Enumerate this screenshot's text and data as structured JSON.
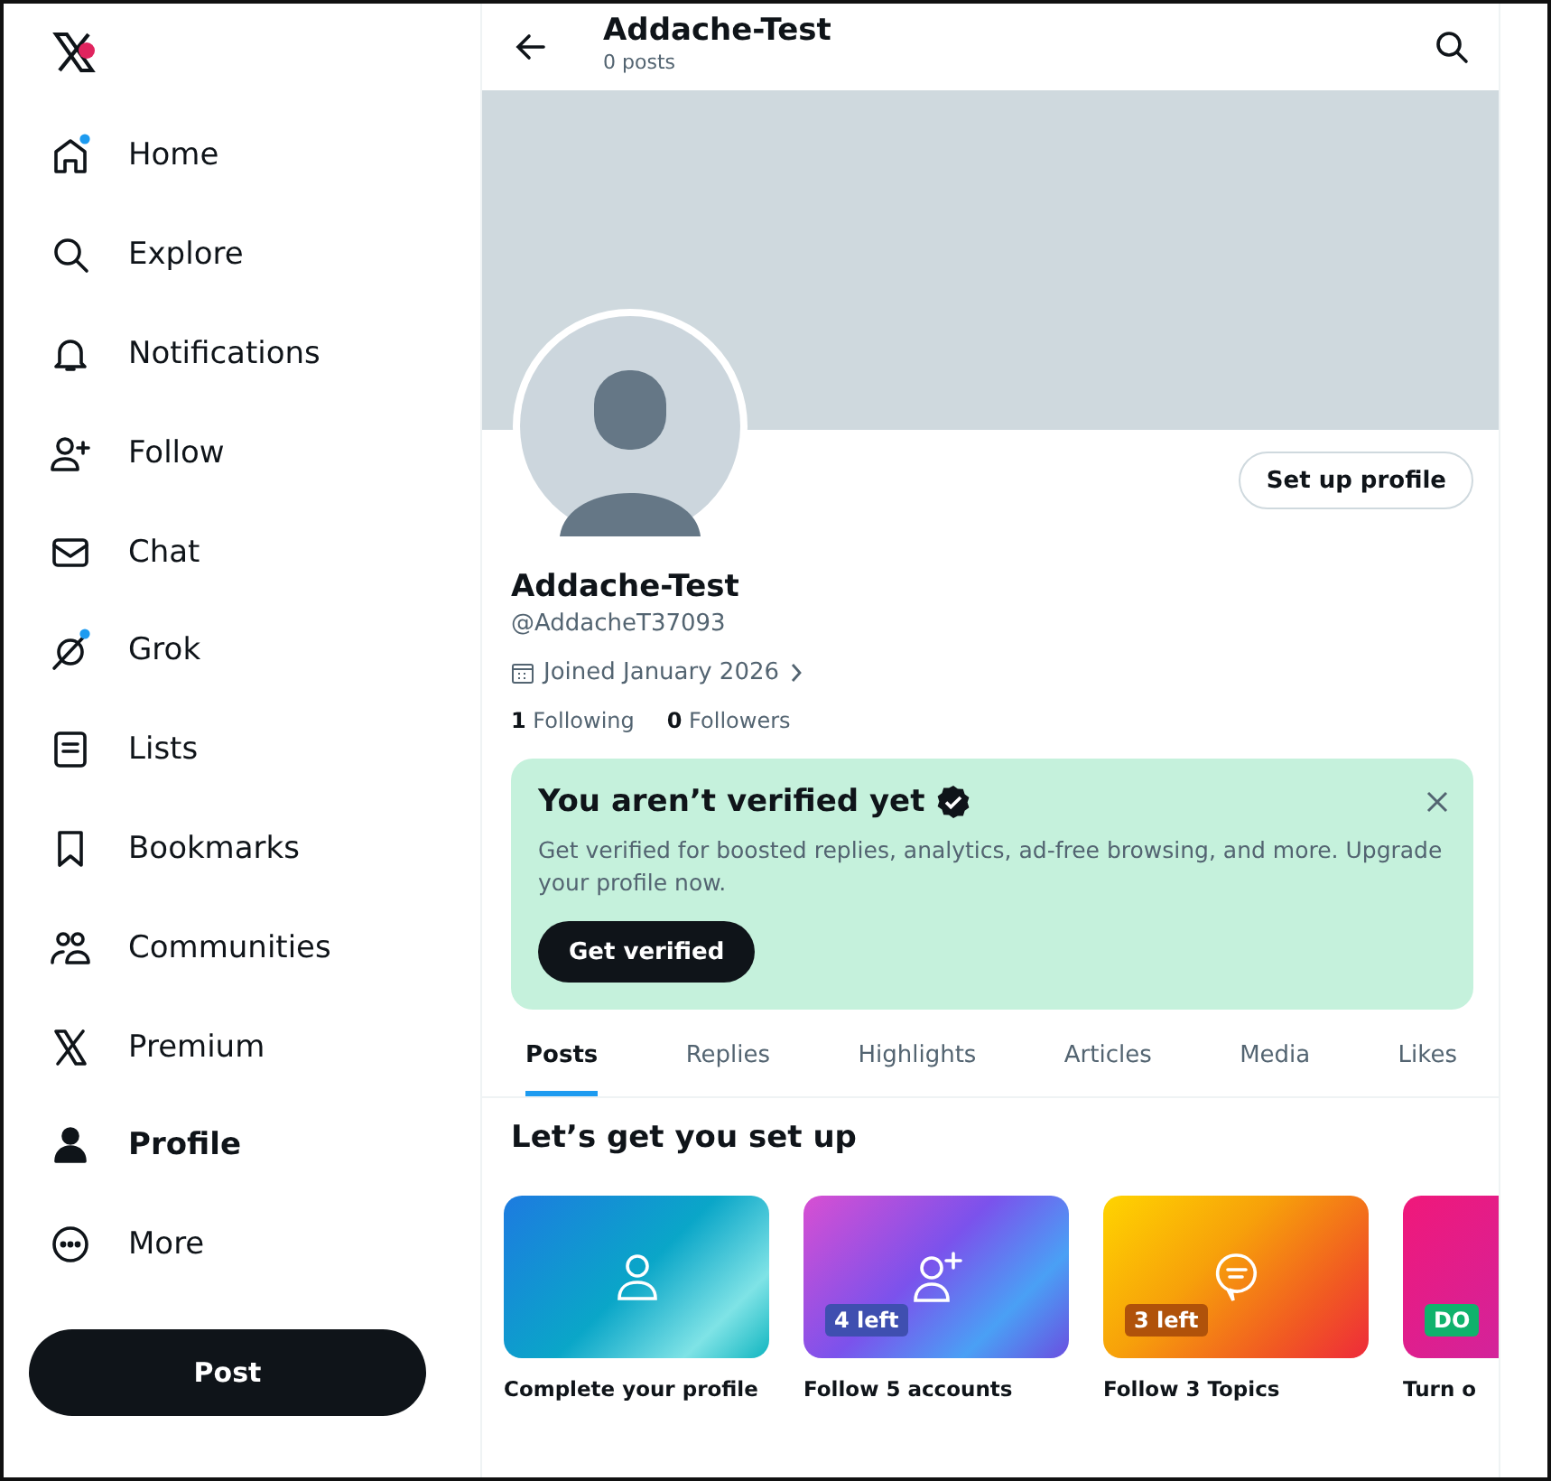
{
  "sidebar": {
    "logo_badge": true,
    "items": [
      {
        "kind": "home",
        "label": "Home",
        "dot": true,
        "selected": false
      },
      {
        "kind": "search",
        "label": "Explore",
        "dot": false,
        "selected": false
      },
      {
        "kind": "bell",
        "label": "Notifications",
        "dot": false,
        "selected": false
      },
      {
        "kind": "person-plus",
        "label": "Follow",
        "dot": false,
        "selected": false
      },
      {
        "kind": "envelope",
        "label": "Chat",
        "dot": false,
        "selected": false
      },
      {
        "kind": "slash-circle",
        "label": "Grok",
        "dot": true,
        "selected": false
      },
      {
        "kind": "list",
        "label": "Lists",
        "dot": false,
        "selected": false
      },
      {
        "kind": "bookmark",
        "label": "Bookmarks",
        "dot": false,
        "selected": false
      },
      {
        "kind": "people",
        "label": "Communities",
        "dot": false,
        "selected": false
      },
      {
        "kind": "x",
        "label": "Premium",
        "dot": false,
        "selected": false
      },
      {
        "kind": "person",
        "label": "Profile",
        "dot": false,
        "selected": true
      },
      {
        "kind": "dots",
        "label": "More",
        "dot": false,
        "selected": false
      }
    ],
    "post_button": "Post"
  },
  "header": {
    "title": "Addache-Test",
    "subtitle": "0 posts"
  },
  "profile": {
    "setup_button": "Set up profile",
    "name": "Addache-Test",
    "handle": "@AddacheT37093",
    "joined": "Joined January 2026",
    "following_count": "1",
    "following_label": "Following",
    "followers_count": "0",
    "followers_label": "Followers"
  },
  "verify_card": {
    "title": "You aren’t verified yet",
    "text": "Get verified for boosted replies, analytics, ad-free browsing, and more. Upgrade your profile now.",
    "button": "Get verified"
  },
  "tabs": [
    {
      "label": "Posts",
      "selected": true
    },
    {
      "label": "Replies",
      "selected": false
    },
    {
      "label": "Highlights",
      "selected": false
    },
    {
      "label": "Articles",
      "selected": false
    },
    {
      "label": "Media",
      "selected": false
    },
    {
      "label": "Likes",
      "selected": false
    }
  ],
  "setup": {
    "title": "Let’s get you set up",
    "cards": [
      {
        "kind": "profile",
        "label": "Complete your profile"
      },
      {
        "kind": "follow",
        "label": "Follow 5 accounts",
        "badge": "4 left"
      },
      {
        "kind": "topics",
        "label": "Follow 3 Topics",
        "badge": "3 left"
      },
      {
        "kind": "notifications",
        "label": "Turn o",
        "badge": "DO"
      }
    ]
  }
}
